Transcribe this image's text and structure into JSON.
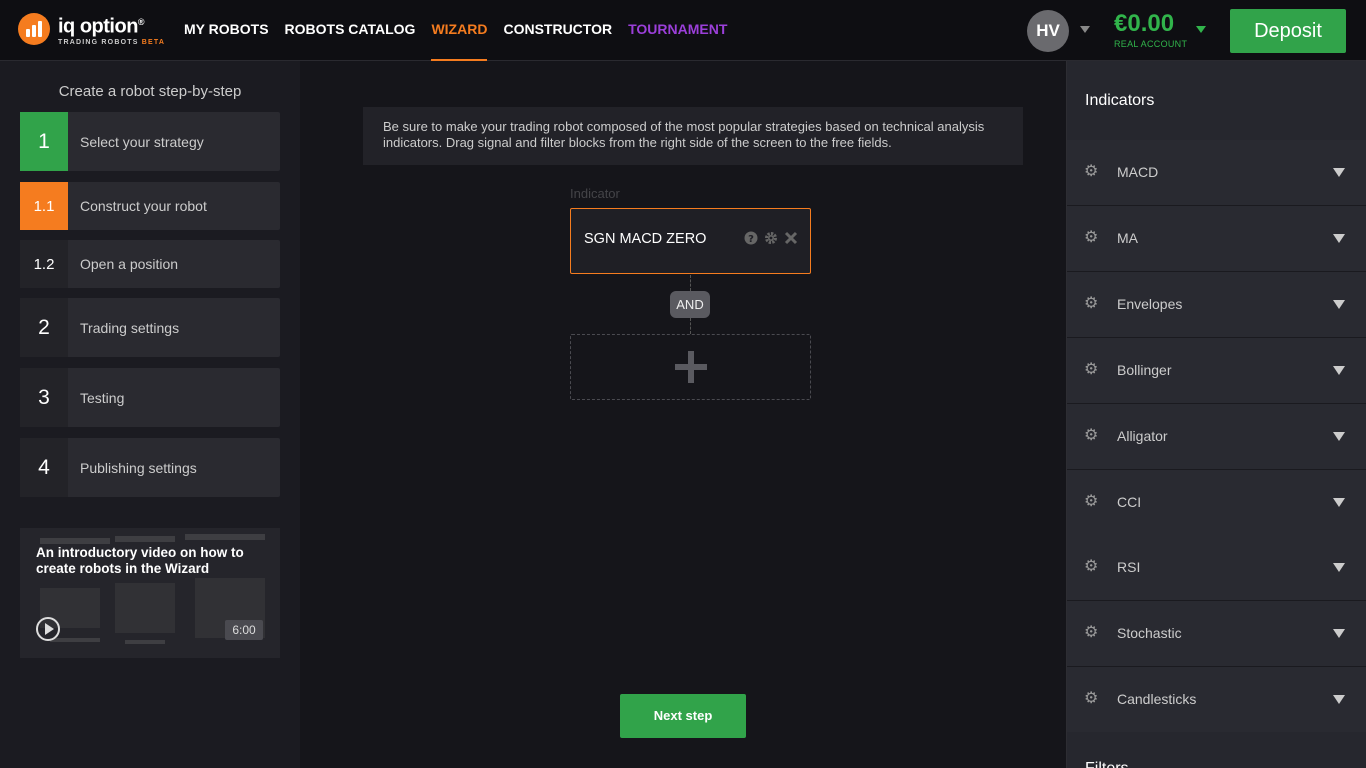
{
  "brand": {
    "name": "iq option",
    "registered": "®",
    "subtitle": "TRADING ROBOTS",
    "beta": "BETA"
  },
  "nav": {
    "items": [
      {
        "label": "MY ROBOTS",
        "state": "normal"
      },
      {
        "label": "ROBOTS CATALOG",
        "state": "normal"
      },
      {
        "label": "WIZARD",
        "state": "active"
      },
      {
        "label": "CONSTRUCTOR",
        "state": "normal"
      },
      {
        "label": "TOURNAMENT",
        "state": "highlight"
      }
    ]
  },
  "account": {
    "initials": "HV",
    "balance": "€0.00",
    "type": "REAL ACCOUNT",
    "deposit_label": "Deposit"
  },
  "sidebar": {
    "title": "Create a robot step-by-step",
    "steps": [
      {
        "num": "1",
        "label": "Select your strategy",
        "status": "done"
      },
      {
        "num": "1.1",
        "label": "Construct your robot",
        "status": "current"
      },
      {
        "num": "1.2",
        "label": "Open a position",
        "status": "pending"
      },
      {
        "num": "2",
        "label": "Trading settings",
        "status": "pending"
      },
      {
        "num": "3",
        "label": "Testing",
        "status": "pending"
      },
      {
        "num": "4",
        "label": "Publishing settings",
        "status": "pending"
      }
    ],
    "video": {
      "title": "An introductory video on how to create robots in the Wizard",
      "duration": "6:00"
    }
  },
  "main": {
    "info": "Be sure to make your trading robot composed of the most popular strategies based on technical analysis indicators. Drag signal and filter blocks from the right side of the screen to the free fields.",
    "indicator_label": "Indicator",
    "indicator_block": "SGN MACD ZERO",
    "and_label": "AND",
    "next_label": "Next step"
  },
  "right_panel": {
    "title": "Indicators",
    "items": [
      "MACD",
      "MA",
      "Envelopes",
      "Bollinger",
      "Alligator",
      "CCI",
      "RSI",
      "Stochastic",
      "Candlesticks"
    ],
    "footer": "Filters"
  },
  "colors": {
    "accent": "#f57c1f",
    "green": "#31a34a",
    "tournament": "#9b3fd9"
  }
}
